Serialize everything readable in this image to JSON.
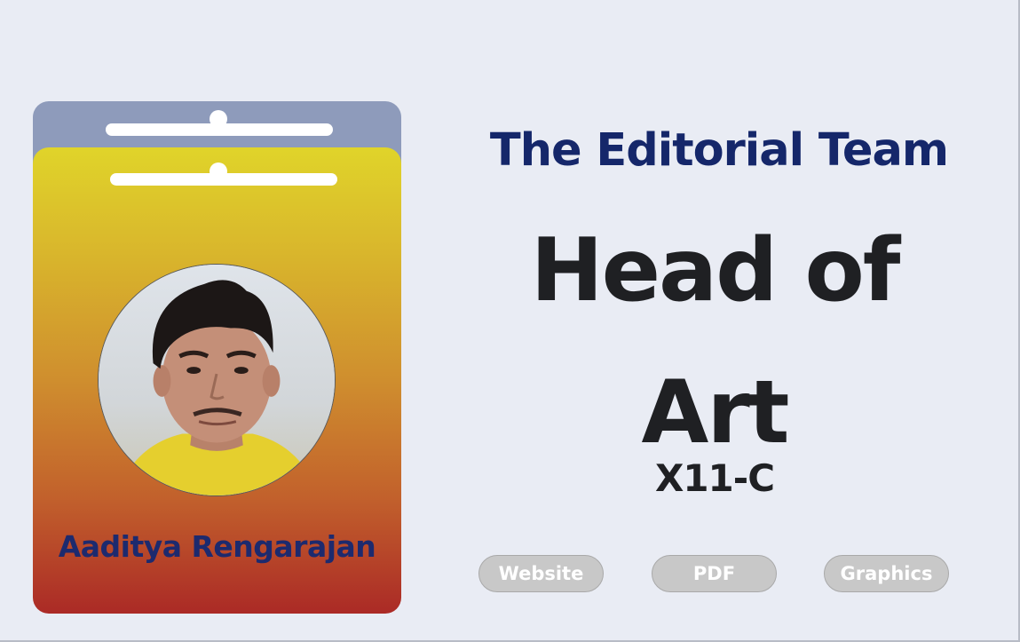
{
  "card": {
    "name": "Aaditya Rengarajan",
    "colors": {
      "back": "#8e9bbb",
      "gradient_top": "#e0d42a",
      "gradient_bottom": "#ab2a26",
      "name": "#1d2a6e"
    }
  },
  "header": {
    "team": "The Editorial Team",
    "role_line1": "Head of",
    "role_line2": "Art",
    "class_code": "X11-C"
  },
  "buttons": [
    {
      "label": "Website"
    },
    {
      "label": "PDF"
    },
    {
      "label": "Graphics"
    }
  ],
  "colors": {
    "background": "#e9ecf4",
    "team_text": "#15276a",
    "role_text": "#1f2023",
    "pill_background": "#c8c8c8"
  }
}
